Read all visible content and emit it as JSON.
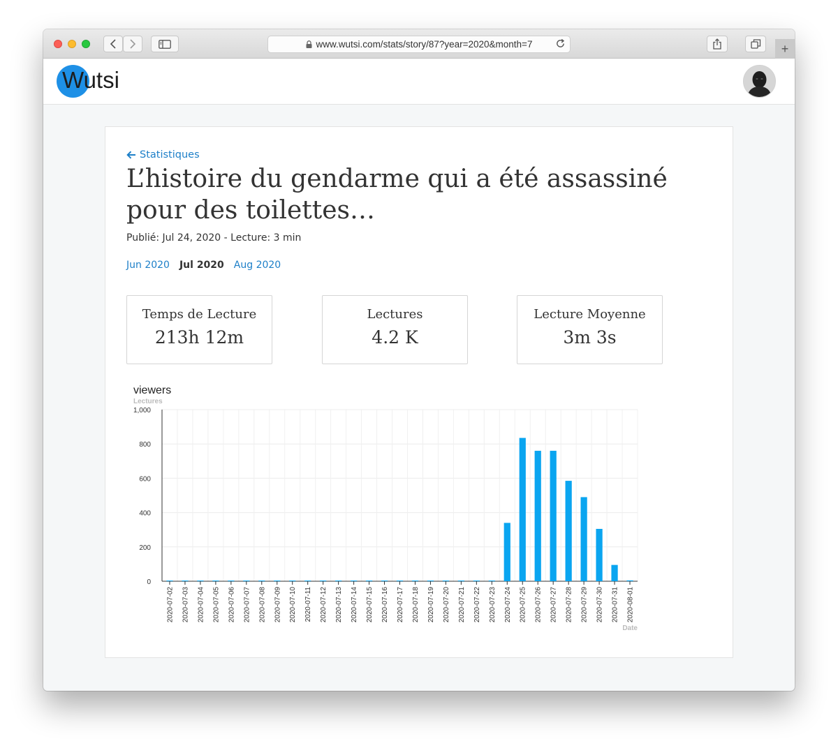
{
  "browser": {
    "url": "www.wutsi.com/stats/story/87?year=2020&month=7",
    "new_tab": "+"
  },
  "site": {
    "logo_letter": "W",
    "logo_rest": "utsi"
  },
  "page": {
    "back_label": "Statistiques",
    "title": "L’histoire du gendarme qui a été assassiné pour des toilettes…",
    "meta": "Publié: Jul 24, 2020 - Lecture: 3 min",
    "months": [
      {
        "label": "Jun 2020",
        "active": false
      },
      {
        "label": "Jul 2020",
        "active": true
      },
      {
        "label": "Aug 2020",
        "active": false
      }
    ]
  },
  "stats": [
    {
      "label": "Temps de Lecture",
      "value": "213h 12m"
    },
    {
      "label": "Lectures",
      "value": "4.2 K"
    },
    {
      "label": "Lecture Moyenne",
      "value": "3m 3s"
    }
  ],
  "colors": {
    "accent": "#1d7fc8",
    "bar": "#0aa5f0"
  },
  "chart_data": {
    "type": "bar",
    "title": "viewers",
    "ylabel": "Lectures",
    "xlabel": "Date",
    "ylim": [
      0,
      1000
    ],
    "yticks": [
      0,
      200,
      400,
      600,
      800,
      1000
    ],
    "ytick_labels": [
      "0",
      "200",
      "400",
      "600",
      "800",
      "1,000"
    ],
    "grid": true,
    "categories": [
      "2020-07-02",
      "2020-07-03",
      "2020-07-04",
      "2020-07-05",
      "2020-07-06",
      "2020-07-07",
      "2020-07-08",
      "2020-07-09",
      "2020-07-10",
      "2020-07-11",
      "2020-07-12",
      "2020-07-13",
      "2020-07-14",
      "2020-07-15",
      "2020-07-16",
      "2020-07-17",
      "2020-07-18",
      "2020-07-19",
      "2020-07-20",
      "2020-07-21",
      "2020-07-22",
      "2020-07-23",
      "2020-07-24",
      "2020-07-25",
      "2020-07-26",
      "2020-07-27",
      "2020-07-28",
      "2020-07-29",
      "2020-07-30",
      "2020-07-31",
      "2020-08-01"
    ],
    "values": [
      0,
      0,
      0,
      0,
      0,
      0,
      0,
      0,
      0,
      0,
      0,
      0,
      0,
      0,
      0,
      0,
      0,
      0,
      0,
      0,
      0,
      0,
      340,
      835,
      760,
      760,
      585,
      490,
      305,
      95,
      5
    ]
  }
}
